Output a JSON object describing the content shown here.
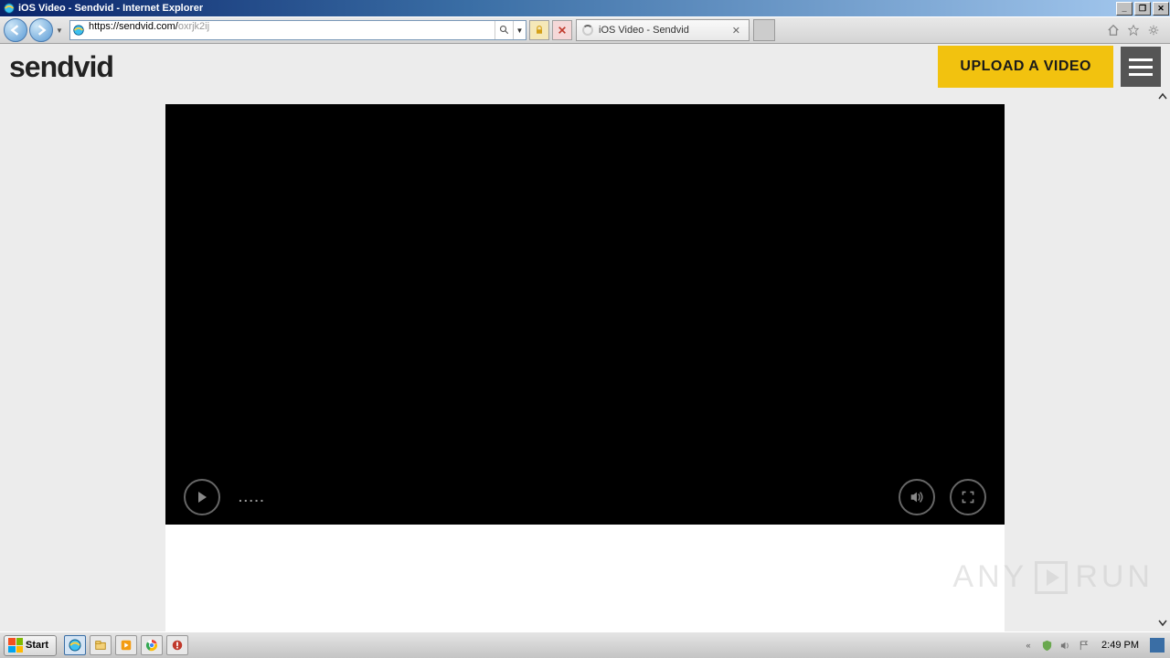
{
  "window": {
    "title": "iOS Video - Sendvid - Internet Explorer"
  },
  "address_bar": {
    "url_dark": "https://sendvid.com/",
    "url_light": "oxrjk2ij"
  },
  "tab": {
    "title": "iOS Video - Sendvid"
  },
  "site": {
    "logo": "sendvid",
    "upload_label": "UPLOAD A VIDEO"
  },
  "player": {
    "time_display": "....."
  },
  "watermark": {
    "left": "ANY",
    "right": "RUN"
  },
  "taskbar": {
    "start": "Start",
    "clock": "2:49 PM"
  }
}
